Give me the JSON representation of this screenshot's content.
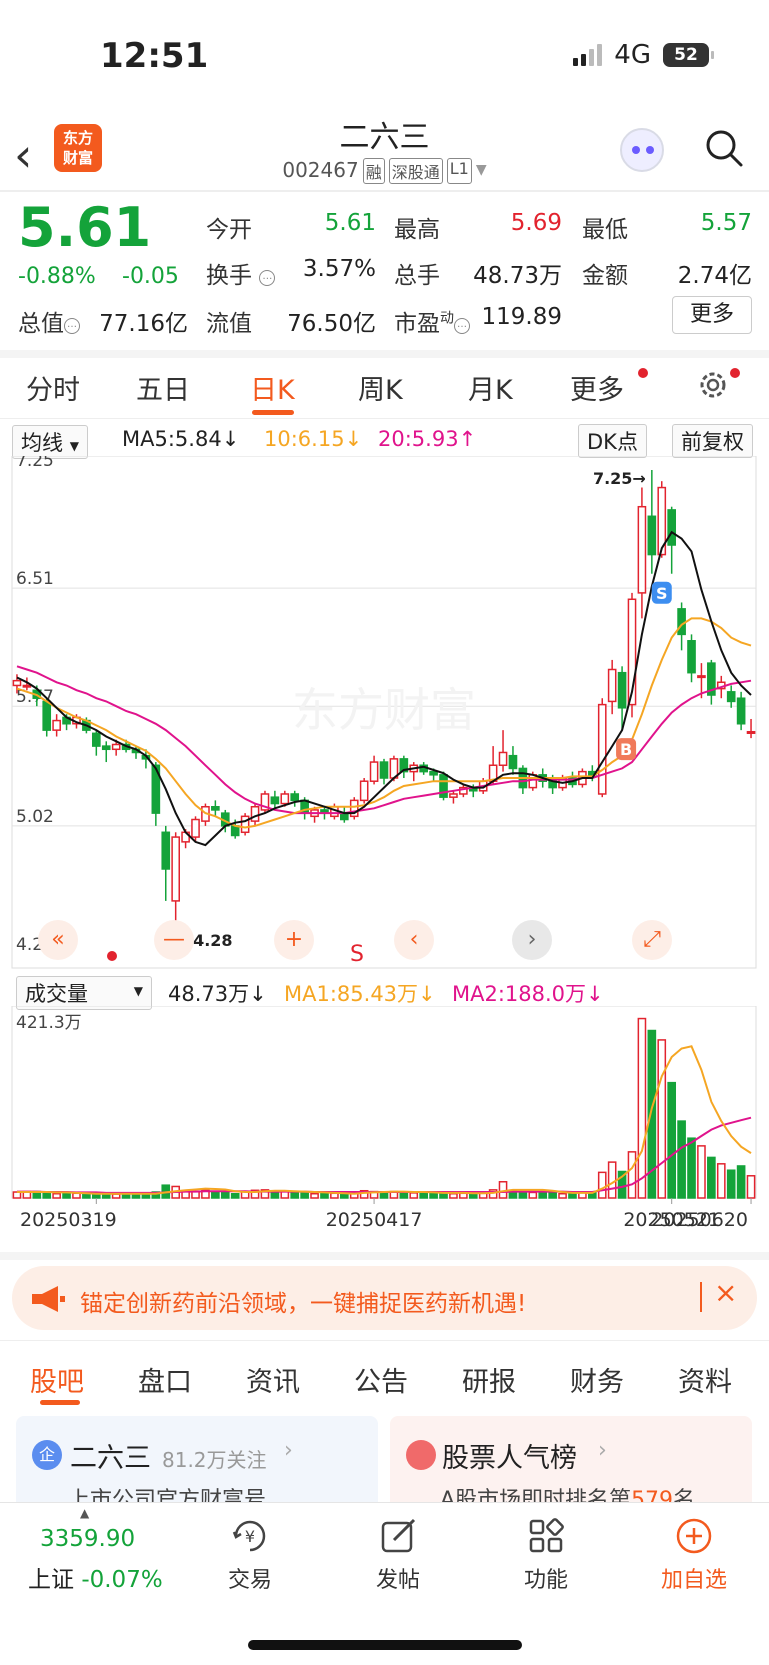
{
  "status": {
    "time": "12:51",
    "network": "4G",
    "battery": "52"
  },
  "header": {
    "title": "二六三",
    "code": "002467",
    "tags": [
      "融",
      "深股通",
      "L1"
    ],
    "logo_line1": "东方",
    "logo_line2": "财富"
  },
  "quote": {
    "price": "5.61",
    "change_pct": "-0.88%",
    "change_amt": "-0.05",
    "open_label": "今开",
    "open": "5.61",
    "high_label": "最高",
    "high": "5.69",
    "low_label": "最低",
    "low": "5.57",
    "turnover_label": "换手",
    "turnover": "3.57%",
    "volume_label": "总手",
    "volume": "48.73万",
    "amount_label": "金额",
    "amount": "2.74亿",
    "mktcap_label": "总值",
    "mktcap": "77.16亿",
    "float_label": "流值",
    "float": "76.50亿",
    "pe_label": "市盈",
    "pe_sup": "动",
    "pe": "119.89",
    "more": "更多"
  },
  "period_tabs": [
    "分时",
    "五日",
    "日K",
    "周K",
    "月K",
    "更多"
  ],
  "active_period": "日K",
  "kline_header": {
    "indicator": "均线",
    "ma5": "MA5:5.84",
    "ma10": "10:6.15",
    "ma20": "20:5.93",
    "dk": "DK点",
    "adjust": "前复权"
  },
  "volume_header": {
    "indicator": "成交量",
    "vol": "48.73万",
    "ma1": "MA1:85.43万",
    "ma2": "MA2:188.0万"
  },
  "colors": {
    "up": "#e2232e",
    "down": "#14a33a",
    "ma5": "#111111",
    "ma10": "#f5a623",
    "ma20": "#e0138c",
    "accent": "#f35a1e"
  },
  "chart_data": {
    "type": "candlestick",
    "y_ticks": [
      "7.25",
      "6.51",
      "5.77",
      "5.02",
      "4.28"
    ],
    "ylim": [
      4.28,
      7.25
    ],
    "max_label": "7.25→",
    "min_label": "←4.28",
    "volume_max_label": "421.3万",
    "x_labels": [
      "20250319",
      "20250417",
      "20250521",
      "20250620"
    ],
    "candles": [
      [
        5.9,
        5.93,
        5.85,
        5.97
      ],
      [
        5.9,
        5.9,
        5.87,
        5.95
      ],
      [
        5.87,
        5.82,
        5.77,
        5.9
      ],
      [
        5.8,
        5.62,
        5.58,
        5.82
      ],
      [
        5.62,
        5.68,
        5.58,
        5.72
      ],
      [
        5.7,
        5.66,
        5.62,
        5.72
      ],
      [
        5.66,
        5.7,
        5.63,
        5.72
      ],
      [
        5.68,
        5.62,
        5.6,
        5.7
      ],
      [
        5.6,
        5.52,
        5.46,
        5.62
      ],
      [
        5.52,
        5.5,
        5.42,
        5.55
      ],
      [
        5.5,
        5.53,
        5.46,
        5.56
      ],
      [
        5.53,
        5.5,
        5.48,
        5.56
      ],
      [
        5.5,
        5.48,
        5.44,
        5.52
      ],
      [
        5.46,
        5.44,
        5.38,
        5.5
      ],
      [
        5.4,
        5.1,
        5.02,
        5.42
      ],
      [
        4.98,
        4.75,
        4.55,
        5.02
      ],
      [
        4.55,
        4.95,
        4.28,
        4.98
      ],
      [
        4.92,
        4.98,
        4.88,
        5.0
      ],
      [
        4.95,
        5.06,
        4.92,
        5.08
      ],
      [
        5.05,
        5.14,
        5.02,
        5.16
      ],
      [
        5.14,
        5.12,
        5.08,
        5.18
      ],
      [
        5.1,
        5.02,
        4.98,
        5.12
      ],
      [
        5.02,
        4.96,
        4.94,
        5.06
      ],
      [
        4.98,
        5.08,
        4.96,
        5.1
      ],
      [
        5.05,
        5.14,
        5.02,
        5.16
      ],
      [
        5.12,
        5.22,
        5.1,
        5.24
      ],
      [
        5.2,
        5.16,
        5.12,
        5.24
      ],
      [
        5.16,
        5.22,
        5.14,
        5.24
      ],
      [
        5.22,
        5.18,
        5.14,
        5.24
      ],
      [
        5.18,
        5.1,
        5.06,
        5.2
      ],
      [
        5.08,
        5.12,
        5.04,
        5.14
      ],
      [
        5.12,
        5.1,
        5.06,
        5.14
      ],
      [
        5.08,
        5.14,
        5.06,
        5.16
      ],
      [
        5.1,
        5.06,
        5.04,
        5.14
      ],
      [
        5.08,
        5.18,
        5.06,
        5.2
      ],
      [
        5.18,
        5.3,
        5.16,
        5.32
      ],
      [
        5.3,
        5.42,
        5.28,
        5.46
      ],
      [
        5.42,
        5.32,
        5.28,
        5.44
      ],
      [
        5.32,
        5.44,
        5.3,
        5.46
      ],
      [
        5.44,
        5.36,
        5.32,
        5.46
      ],
      [
        5.36,
        5.4,
        5.3,
        5.42
      ],
      [
        5.4,
        5.36,
        5.34,
        5.42
      ],
      [
        5.36,
        5.34,
        5.3,
        5.38
      ],
      [
        5.34,
        5.2,
        5.18,
        5.36
      ],
      [
        5.2,
        5.22,
        5.16,
        5.24
      ],
      [
        5.22,
        5.26,
        5.2,
        5.28
      ],
      [
        5.26,
        5.24,
        5.2,
        5.28
      ],
      [
        5.24,
        5.3,
        5.22,
        5.32
      ],
      [
        5.3,
        5.4,
        5.28,
        5.52
      ],
      [
        5.4,
        5.48,
        5.36,
        5.62
      ],
      [
        5.46,
        5.38,
        5.34,
        5.52
      ],
      [
        5.38,
        5.26,
        5.22,
        5.4
      ],
      [
        5.26,
        5.34,
        5.24,
        5.36
      ],
      [
        5.34,
        5.3,
        5.26,
        5.38
      ],
      [
        5.3,
        5.26,
        5.22,
        5.34
      ],
      [
        5.26,
        5.32,
        5.24,
        5.34
      ],
      [
        5.32,
        5.28,
        5.26,
        5.36
      ],
      [
        5.28,
        5.36,
        5.26,
        5.38
      ],
      [
        5.36,
        5.34,
        5.3,
        5.4
      ],
      [
        5.22,
        5.78,
        5.2,
        5.82
      ],
      [
        5.8,
        6.0,
        5.72,
        6.06
      ],
      [
        5.98,
        5.76,
        5.62,
        6.02
      ],
      [
        5.78,
        6.44,
        5.7,
        6.48
      ],
      [
        6.48,
        7.02,
        6.32,
        7.14
      ],
      [
        6.96,
        6.72,
        6.6,
        7.25
      ],
      [
        6.72,
        7.14,
        6.7,
        7.18
      ],
      [
        7.0,
        6.78,
        6.6,
        7.02
      ],
      [
        6.38,
        6.22,
        6.12,
        6.42
      ],
      [
        6.18,
        5.98,
        5.92,
        6.22
      ],
      [
        5.96,
        5.96,
        5.82,
        6.04
      ],
      [
        6.04,
        5.84,
        5.78,
        6.06
      ],
      [
        5.88,
        5.92,
        5.82,
        5.96
      ],
      [
        5.86,
        5.8,
        5.76,
        5.9
      ],
      [
        5.82,
        5.66,
        5.62,
        5.86
      ],
      [
        5.61,
        5.61,
        5.57,
        5.69
      ]
    ],
    "volumes": [
      14,
      15,
      15,
      13,
      10,
      10,
      11,
      10,
      10,
      10,
      9,
      10,
      9,
      10,
      14,
      30,
      27,
      16,
      15,
      18,
      14,
      13,
      10,
      15,
      18,
      19,
      16,
      15,
      13,
      11,
      10,
      10,
      11,
      10,
      10,
      17,
      15,
      14,
      15,
      13,
      12,
      12,
      12,
      11,
      10,
      11,
      10,
      11,
      19,
      38,
      16,
      12,
      13,
      13,
      12,
      10,
      12,
      14,
      12,
      60,
      84,
      62,
      108,
      420,
      392,
      370,
      270,
      180,
      140,
      122,
      95,
      80,
      65,
      75,
      52
    ],
    "ma_lines": {
      "ma5": [
        5.95,
        5.92,
        5.88,
        5.82,
        5.76,
        5.7,
        5.67,
        5.65,
        5.62,
        5.58,
        5.55,
        5.52,
        5.5,
        5.46,
        5.38,
        5.25,
        5.1,
        4.98,
        4.92,
        4.9,
        4.96,
        5.02,
        5.04,
        5.05,
        5.08,
        5.1,
        5.13,
        5.15,
        5.17,
        5.18,
        5.16,
        5.14,
        5.12,
        5.1,
        5.1,
        5.14,
        5.2,
        5.26,
        5.32,
        5.37,
        5.38,
        5.39,
        5.37,
        5.35,
        5.31,
        5.28,
        5.26,
        5.26,
        5.3,
        5.34,
        5.35,
        5.35,
        5.34,
        5.32,
        5.3,
        5.29,
        5.3,
        5.32,
        5.32,
        5.42,
        5.52,
        5.62,
        5.86,
        6.22,
        6.52,
        6.76,
        6.86,
        6.82,
        6.74,
        6.5,
        6.3,
        6.12,
        5.98,
        5.9,
        5.84
      ],
      "ma10": [
        5.88,
        5.86,
        5.84,
        5.8,
        5.76,
        5.73,
        5.7,
        5.68,
        5.65,
        5.62,
        5.58,
        5.55,
        5.52,
        5.49,
        5.44,
        5.38,
        5.3,
        5.22,
        5.15,
        5.1,
        5.08,
        5.05,
        5.02,
        5.01,
        5.02,
        5.04,
        5.06,
        5.08,
        5.1,
        5.12,
        5.13,
        5.14,
        5.14,
        5.14,
        5.14,
        5.15,
        5.17,
        5.2,
        5.24,
        5.27,
        5.28,
        5.29,
        5.3,
        5.3,
        5.3,
        5.3,
        5.3,
        5.3,
        5.31,
        5.32,
        5.32,
        5.32,
        5.32,
        5.32,
        5.32,
        5.32,
        5.33,
        5.33,
        5.33,
        5.37,
        5.42,
        5.46,
        5.56,
        5.72,
        5.9,
        6.06,
        6.2,
        6.28,
        6.32,
        6.32,
        6.3,
        6.26,
        6.2,
        6.17,
        6.15
      ],
      "ma20": [
        6.02,
        6.0,
        5.98,
        5.95,
        5.92,
        5.9,
        5.87,
        5.85,
        5.82,
        5.8,
        5.77,
        5.74,
        5.72,
        5.69,
        5.66,
        5.62,
        5.57,
        5.52,
        5.46,
        5.4,
        5.34,
        5.28,
        5.23,
        5.19,
        5.16,
        5.14,
        5.12,
        5.11,
        5.1,
        5.1,
        5.1,
        5.1,
        5.1,
        5.1,
        5.11,
        5.12,
        5.13,
        5.15,
        5.17,
        5.19,
        5.2,
        5.21,
        5.22,
        5.23,
        5.24,
        5.25,
        5.26,
        5.27,
        5.28,
        5.29,
        5.3,
        5.3,
        5.31,
        5.31,
        5.31,
        5.31,
        5.31,
        5.32,
        5.32,
        5.34,
        5.36,
        5.38,
        5.42,
        5.5,
        5.58,
        5.66,
        5.73,
        5.78,
        5.82,
        5.85,
        5.87,
        5.89,
        5.91,
        5.92,
        5.93
      ],
      "vol_ma1": [
        14,
        14,
        14,
        14,
        13,
        13,
        12,
        11,
        10,
        10,
        10,
        10,
        10,
        10,
        10,
        13,
        16,
        18,
        20,
        22,
        21,
        20,
        16,
        14,
        14,
        16,
        17,
        17,
        16,
        15,
        14,
        13,
        12,
        11,
        10,
        12,
        13,
        14,
        15,
        15,
        14,
        14,
        13,
        12,
        12,
        12,
        11,
        11,
        12,
        16,
        19,
        19,
        19,
        19,
        17,
        14,
        12,
        12,
        12,
        22,
        35,
        50,
        70,
        110,
        210,
        285,
        330,
        350,
        355,
        300,
        225,
        180,
        145,
        120,
        105
      ],
      "vol_ma2": [
        15,
        15,
        15,
        14,
        14,
        14,
        13,
        13,
        13,
        12,
        12,
        12,
        12,
        12,
        12,
        13,
        14,
        15,
        15,
        16,
        16,
        16,
        16,
        16,
        15,
        15,
        15,
        15,
        15,
        15,
        14,
        14,
        14,
        14,
        14,
        14,
        14,
        14,
        14,
        14,
        14,
        14,
        14,
        14,
        14,
        14,
        14,
        14,
        14,
        14,
        15,
        15,
        15,
        15,
        15,
        15,
        14,
        14,
        14,
        18,
        22,
        26,
        32,
        46,
        64,
        82,
        100,
        118,
        130,
        145,
        160,
        170,
        176,
        182,
        188
      ]
    }
  },
  "banner": {
    "text": "锚定创新药前沿领域，一键捕捉医药新机遇!"
  },
  "section_tabs": [
    "股吧",
    "盘口",
    "资讯",
    "公告",
    "研报",
    "财务",
    "资料"
  ],
  "active_section": "股吧",
  "cards": {
    "left_title": "二六三",
    "left_follow": "81.2万关注",
    "left_sub": "上市公司官方财富号",
    "right_title": "股票人气榜",
    "right_sub_pre": "A股市场即时排名第",
    "right_rank": "579",
    "right_sub_post": "名"
  },
  "bottom": {
    "index_value": "3359.90",
    "index_name": "上证",
    "index_chg": "-0.07%",
    "trade": "交易",
    "post": "发帖",
    "func": "功能",
    "watch": "加自选"
  },
  "ctrl_labels": {
    "s": "S"
  },
  "markers": {
    "sell": "S",
    "buy": "B"
  }
}
